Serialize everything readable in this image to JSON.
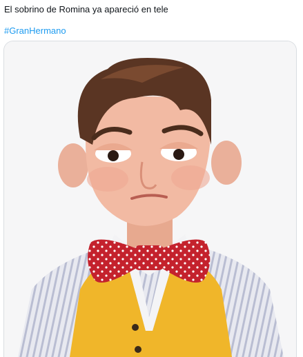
{
  "tweet": {
    "text": "El sobrino de Romina ya apareció en tele",
    "hashtag": "#GranHermano"
  },
  "media": {
    "description_icon": "puppet-character-image"
  },
  "colors": {
    "text": "#0f1419",
    "link": "#1d9bf0",
    "border": "#d9dde1"
  }
}
